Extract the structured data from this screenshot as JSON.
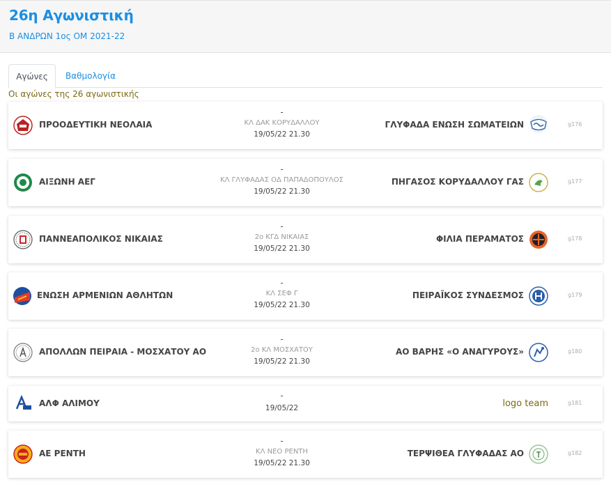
{
  "header": {
    "title": "26η Αγωνιστική",
    "subtitle": "Β ΑΝΔΡΩΝ 1ος ΟΜ 2021-22"
  },
  "tabs": [
    {
      "label": "Αγώνες",
      "active": true
    },
    {
      "label": "Βαθμολογία",
      "active": false
    }
  ],
  "caption": "Οι αγώνες της 26 αγωνιστικής",
  "matches": [
    {
      "home": "ΠΡΟΟΔΕΥΤΙΚΗ ΝΕΟΛΑΙΑ",
      "away": "ΓΛΥΦΑΔΑ ΕΝΩΣΗ ΣΩΜΑΤΕΙΩΝ",
      "score": "-",
      "venue": "ΚΛ ΔΑΚ ΚΟΡΥΔΑΛΛΟΥ",
      "datetime": "19/05/22 21.30",
      "code": "g176",
      "home_icon": "proodeftiki-logo-icon",
      "away_icon": "glyfada-logo-icon"
    },
    {
      "home": "ΑΙΞΩΝΗ ΑΕΓ",
      "away": "ΠΗΓΑΣΟΣ ΚΟΡΥΔΑΛΛΟΥ ΓΑΣ",
      "score": "-",
      "venue": "ΚΛ ΓΛΥΦΑΔΑΣ ΟΔ ΠΑΠΑΔΟΠΟΥΛΟΣ",
      "datetime": "19/05/22 21.30",
      "code": "g177",
      "home_icon": "aixoni-logo-icon",
      "away_icon": "pigasos-logo-icon"
    },
    {
      "home": "ΠΑΝΝΕΑΠΟΛΙΚΟΣ ΝΙΚΑΙΑΣ",
      "away": "ΦΙΛΙΑ ΠΕΡΑΜΑΤΟΣ",
      "score": "-",
      "venue": "2ο ΚΓΔ ΝΙΚΑΙΑΣ",
      "datetime": "19/05/22 21.30",
      "code": "g178",
      "home_icon": "panneapolikos-logo-icon",
      "away_icon": "filia-logo-icon"
    },
    {
      "home": "ΕΝΩΣΗ ΑΡΜΕΝΙΩΝ ΑΘΛΗΤΩΝ",
      "away": "ΠΕΙΡΑΪΚΟΣ ΣΥΝΔΕΣΜΟΣ",
      "score": "-",
      "venue": "ΚΛ ΣΕΦ Γ",
      "datetime": "19/05/22 21.30",
      "code": "g179",
      "home_icon": "armenion-logo-icon",
      "away_icon": "peiraikos-logo-icon"
    },
    {
      "home": "ΑΠΟΛΛΩΝ ΠΕΙΡΑΙΑ - ΜΟΣΧΑΤΟΥ ΑΟ",
      "away": "ΑΟ ΒΑΡΗΣ «Ο ΑΝΑΓΥΡΟΥΣ»",
      "score": "-",
      "venue": "2ο ΚΛ ΜΟΣΧΑΤΟΥ",
      "datetime": "19/05/22 21.30",
      "code": "g180",
      "home_icon": "apollon-logo-icon",
      "away_icon": "varis-logo-icon"
    },
    {
      "home": "ΑΛΦ ΑΛΙΜΟΥ",
      "away": "logo team",
      "score": "-",
      "venue": "",
      "datetime": "19/05/22",
      "code": "g181",
      "home_icon": "alf-logo-icon",
      "away_icon": ""
    },
    {
      "home": "ΑΕ ΡΕΝΤΗ",
      "away": "ΤΕΡΨΙΘΕΑ ΓΛΥΦΑΔΑΣ ΑΟ",
      "score": "-",
      "venue": "ΚΛ ΝΕΟ ΡΕΝΤΗ",
      "datetime": "19/05/22 21.30",
      "code": "g182",
      "home_icon": "rentis-logo-icon",
      "away_icon": "terpsithea-logo-icon"
    }
  ],
  "colors": {
    "accent": "#1a8fe3",
    "caption": "#7a6a10"
  }
}
